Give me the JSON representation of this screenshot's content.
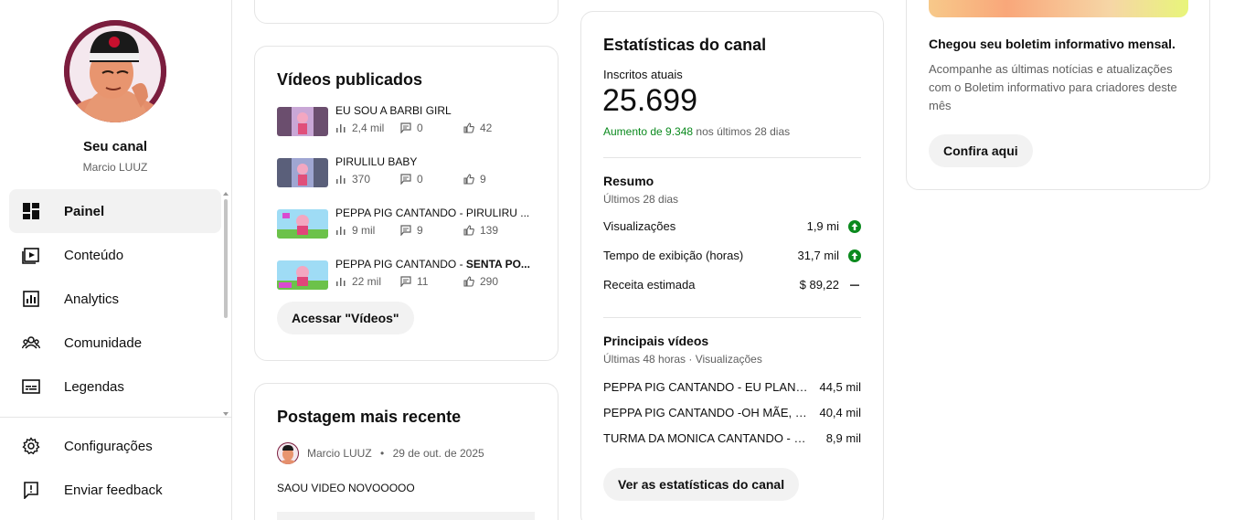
{
  "sidebar": {
    "channel_title": "Seu canal",
    "channel_handle": "Marcio LUUZ",
    "items": [
      {
        "label": "Painel",
        "icon": "dashboard-icon",
        "active": true
      },
      {
        "label": "Conteúdo",
        "icon": "content-icon"
      },
      {
        "label": "Analytics",
        "icon": "analytics-icon"
      },
      {
        "label": "Comunidade",
        "icon": "community-icon"
      },
      {
        "label": "Legendas",
        "icon": "subtitles-icon"
      }
    ],
    "bottom_items": [
      {
        "label": "Configurações",
        "icon": "gear-icon"
      },
      {
        "label": "Enviar feedback",
        "icon": "feedback-icon"
      }
    ]
  },
  "published_videos": {
    "title": "Vídeos publicados",
    "videos": [
      {
        "title": "EU SOU A BARBI GIRL",
        "views": "2,4 mil",
        "comments": "0",
        "likes": "42"
      },
      {
        "title": "PIRULILU BABY",
        "views": "370",
        "comments": "0",
        "likes": "9"
      },
      {
        "title": "PEPPA PIG CANTANDO - PIRULIRU ...",
        "views": "9 mil",
        "comments": "9",
        "likes": "139"
      },
      {
        "title_normal": "PEPPA PIG CANTANDO - ",
        "title_bold": "SENTA PO...",
        "views": "22 mil",
        "comments": "11",
        "likes": "290"
      }
    ],
    "button": "Acessar \"Vídeos\""
  },
  "recent_post": {
    "title": "Postagem mais recente",
    "author": "Marcio LUUZ",
    "separator": "•",
    "date": "29 de out. de 2025",
    "text": "SAOU VIDEO NOVOOOOO"
  },
  "channel_stats": {
    "title": "Estatísticas do canal",
    "subscribers_label": "Inscritos atuais",
    "subscribers": "25.699",
    "increase_prefix": "Aumento de 9.348",
    "increase_suffix": " nos últimos 28 dias",
    "summary_title": "Resumo",
    "summary_period": "Últimos 28 dias",
    "metrics": [
      {
        "name": "Visualizações",
        "value": "1,9 mi",
        "trend": "up"
      },
      {
        "name": "Tempo de exibição (horas)",
        "value": "31,7 mil",
        "trend": "up"
      },
      {
        "name": "Receita estimada",
        "value": "$ 89,22",
        "trend": "flat"
      }
    ],
    "top_title": "Principais vídeos",
    "top_period": "Últimas 48 horas · Visualizações",
    "top_videos": [
      {
        "name": "PEPPA PIG CANTANDO - EU PLANTEI ...",
        "value": "44,5 mil"
      },
      {
        "name": "PEPPA PIG CANTANDO -OH MÃE, CO...",
        "value": "40,4 mil"
      },
      {
        "name": "TURMA DA MONICA CANTANDO - EU ...",
        "value": "8,9 mil"
      }
    ],
    "button": "Ver as estatísticas do canal"
  },
  "newsletter": {
    "title": "Chegou seu boletim informativo mensal.",
    "body": "Acompanhe as últimas notícias e atualizações com o Boletim informativo para criadores deste mês",
    "button": "Confira aqui"
  },
  "colors": {
    "accent_green": "#0b8a1e",
    "pill_bg": "#f2f2f2",
    "border": "#e5e5e5"
  }
}
